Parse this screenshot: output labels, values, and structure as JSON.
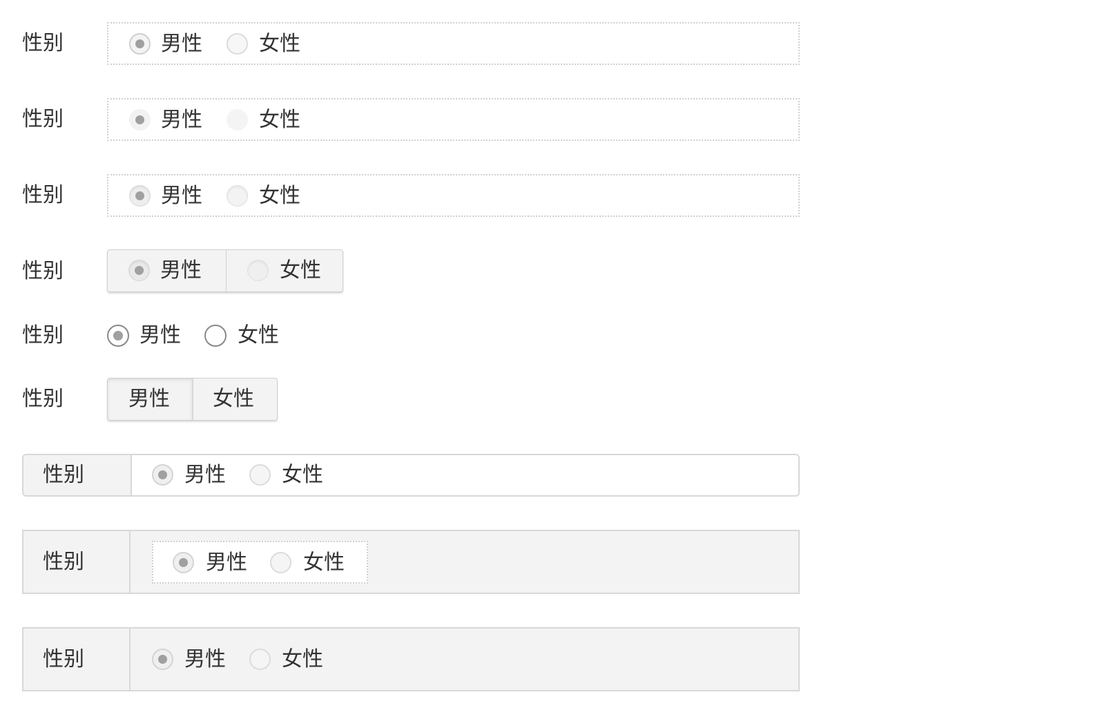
{
  "field_label": "性别",
  "options": [
    "男性",
    "女性"
  ],
  "selected": "男性",
  "rows": [
    {
      "variant": "dotted-box-flat",
      "label": "性别",
      "option_1": "男性",
      "option_2": "女性"
    },
    {
      "variant": "dotted-box-soft",
      "label": "性别",
      "option_1": "男性",
      "option_2": "女性"
    },
    {
      "variant": "dotted-box-shaded",
      "label": "性别",
      "option_1": "男性",
      "option_2": "女性"
    },
    {
      "variant": "button-group-radios",
      "label": "性别",
      "option_1": "男性",
      "option_2": "女性"
    },
    {
      "variant": "plain-radios",
      "label": "性别",
      "option_1": "男性",
      "option_2": "女性"
    },
    {
      "variant": "segmented-buttons",
      "label": "性别",
      "option_1": "男性",
      "option_2": "女性"
    },
    {
      "variant": "inline-table-rounded",
      "label": "性别",
      "option_1": "男性",
      "option_2": "女性"
    },
    {
      "variant": "table-with-dotted-inner",
      "label": "性别",
      "option_1": "男性",
      "option_2": "女性"
    },
    {
      "variant": "table-gray",
      "label": "性别",
      "option_1": "男性",
      "option_2": "女性"
    }
  ],
  "colors": {
    "text": "#333333",
    "border": "#cfcfcf",
    "panel": "#f3f3f3",
    "dot": "#a0a0a0"
  }
}
